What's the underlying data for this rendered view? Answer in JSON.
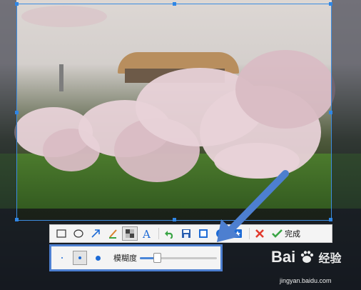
{
  "toolbar": {
    "tools": [
      {
        "icon": "rectangle-icon"
      },
      {
        "icon": "ellipse-icon"
      },
      {
        "icon": "arrow-icon"
      },
      {
        "icon": "brush-icon"
      },
      {
        "icon": "mosaic-icon",
        "active": true
      },
      {
        "icon": "text-icon"
      },
      {
        "icon": "undo-icon"
      },
      {
        "icon": "save-icon"
      },
      {
        "icon": "copy-icon"
      },
      {
        "icon": "share-icon"
      },
      {
        "icon": "pin-icon"
      },
      {
        "icon": "cancel-icon"
      }
    ],
    "done_label": "完成"
  },
  "subbar": {
    "sizes": [
      "small",
      "medium",
      "large"
    ],
    "selected_size": "medium",
    "blur_label": "模糊度",
    "blur_level": 0.2
  },
  "watermark": {
    "brand_left": "Bai",
    "brand_right": "经验",
    "url": "jingyan.baidu.com"
  },
  "colors": {
    "selection": "#3d8de0",
    "arrow": "#4d7fd0",
    "cancel": "#e23b2e",
    "done": "#3aa545"
  }
}
